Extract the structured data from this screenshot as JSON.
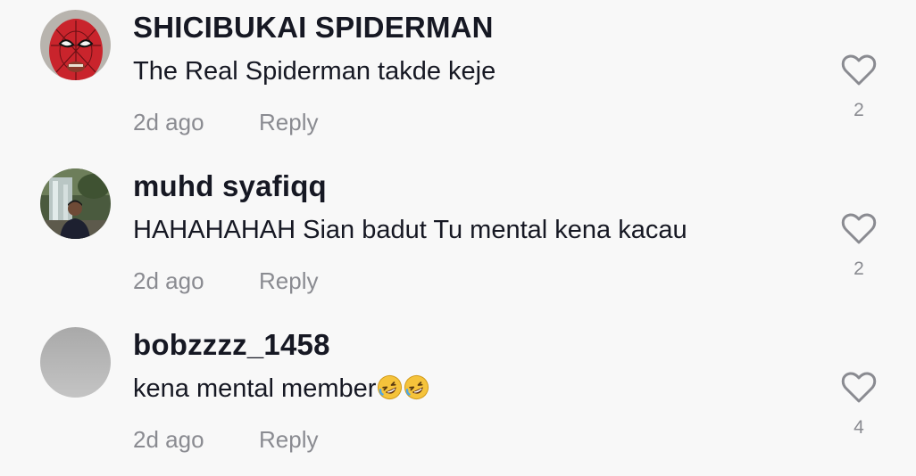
{
  "comments": [
    {
      "username": "SHICIBUKAI SPIDERMAN",
      "text": "The Real Spiderman takde keje",
      "time": "2d ago",
      "reply_label": "Reply",
      "likes": "2",
      "avatar": "spiderman-mask"
    },
    {
      "username": "muhd syafiqq",
      "text": "HAHAHAHAH Sian badut Tu mental kena kacau",
      "time": "2d ago",
      "reply_label": "Reply",
      "likes": "2",
      "avatar": "person-waterfall"
    },
    {
      "username": "bobzzzz_1458",
      "text": "kena mental member",
      "emoji": "🤣🤣",
      "time": "2d ago",
      "reply_label": "Reply",
      "likes": "4",
      "avatar": "gray-blank"
    }
  ],
  "colors": {
    "background": "#f8f8f8",
    "primary_text": "#161823",
    "secondary_text": "#8a8b91"
  },
  "icons": {
    "like": "heart-outline-icon",
    "emoji": "rolling-on-floor-laughing"
  }
}
